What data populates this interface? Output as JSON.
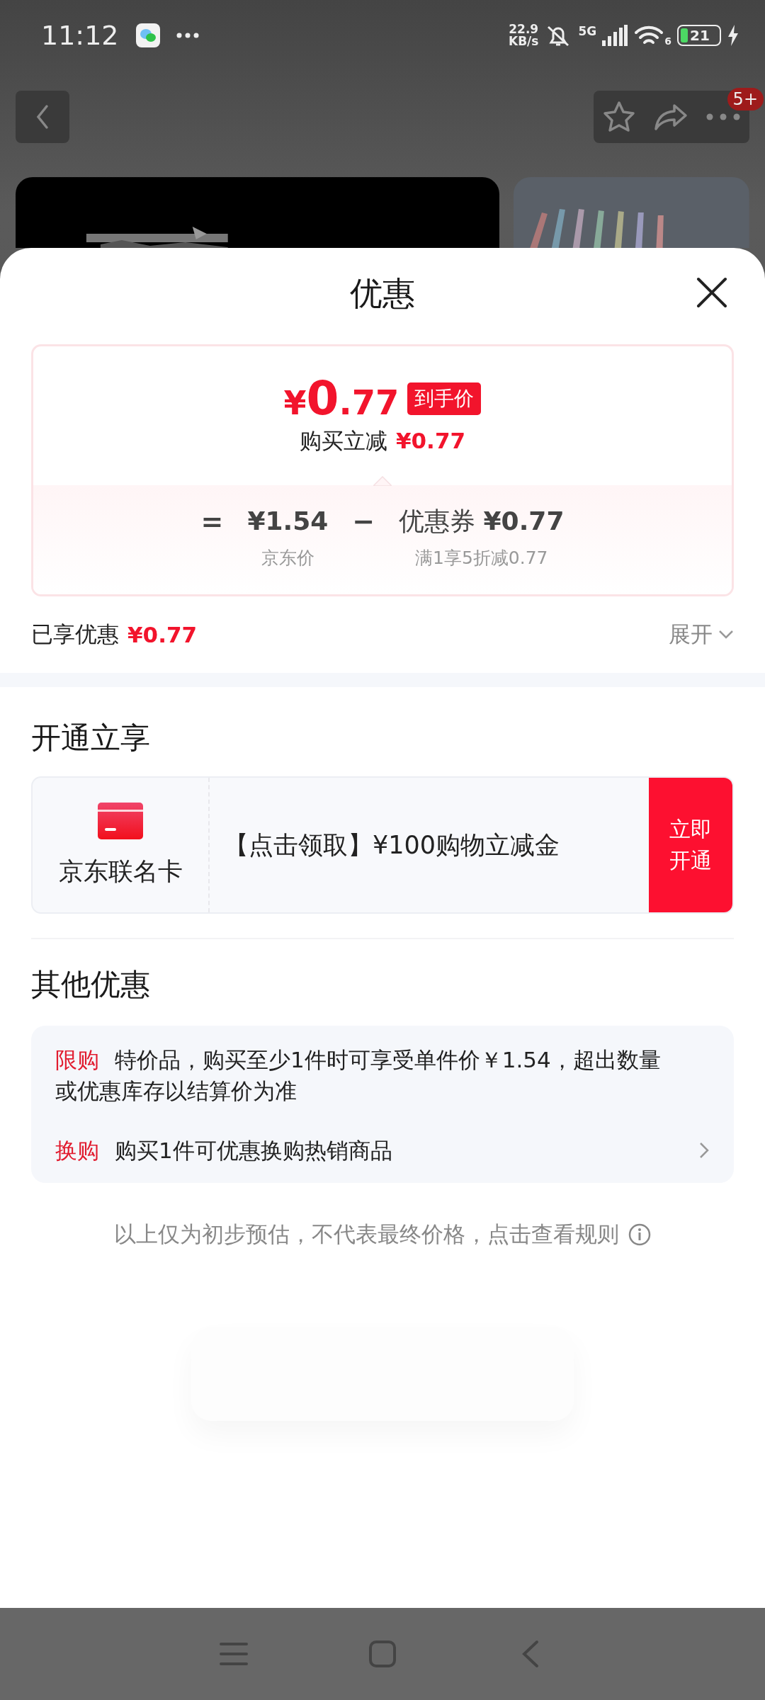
{
  "status_bar": {
    "time": "11:12",
    "net_speed": "22.9",
    "net_unit": "KB/s",
    "network": "5G",
    "wifi_label": "6",
    "battery": "21",
    "charging": true
  },
  "top_nav": {
    "badge": "5+"
  },
  "sheet": {
    "title": "优惠"
  },
  "price_card": {
    "final_price": {
      "symbol": "¥",
      "integer": "0",
      "decimal": ".77"
    },
    "final_tag": "到手价",
    "saving_label": "购买立减",
    "saving_amount": "¥0.77",
    "formula": [
      {
        "kind": "sign",
        "text": "="
      },
      {
        "kind": "term",
        "value": "¥1.54",
        "caption": "京东价"
      },
      {
        "kind": "sign",
        "text": "−"
      },
      {
        "kind": "term",
        "label": "优惠券",
        "value": "¥0.77",
        "caption": "满1享5折减0.77"
      }
    ]
  },
  "enjoyed": {
    "label": "已享优惠",
    "amount": "¥0.77",
    "toggle": "展开",
    "expanded": false
  },
  "open_section": {
    "title": "开通立享",
    "card_name": "京东联名卡",
    "offer": "【点击领取】¥100购物立减金",
    "button": "立即开通"
  },
  "other_section": {
    "title": "其他优惠",
    "items": [
      {
        "tag": "限购",
        "text": "特价品，购买至少1件时可享受单件价￥1.54，超出数量或优惠库存以结算价为准",
        "has_arrow": false
      },
      {
        "tag": "换购",
        "text": "购买1件可优惠换购热销商品",
        "has_arrow": true
      }
    ]
  },
  "note": "以上仅为初步预估，不代表最终价格，点击查看规则"
}
